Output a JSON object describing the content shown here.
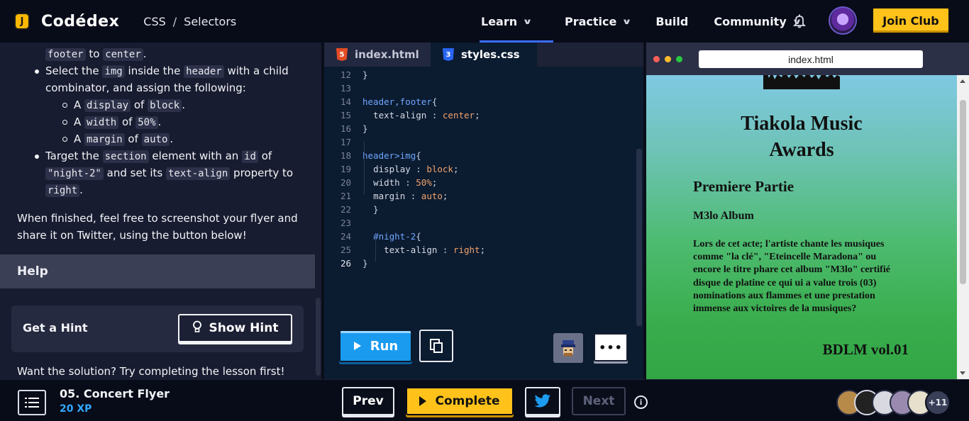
{
  "brand": {
    "name": "Codédex",
    "badge": "J"
  },
  "breadcrumb": {
    "course": "CSS",
    "separator": "/",
    "lesson": "Selectors"
  },
  "nav": {
    "learn": "Learn",
    "practice": "Practice",
    "build": "Build",
    "community": "Community",
    "join": "Join Club"
  },
  "lesson": {
    "frag_top_a": "footer",
    "frag_top_to": "to",
    "frag_top_b": "center",
    "b1_pre": "Select the",
    "b1_code1": "img",
    "b1_mid": "inside the",
    "b1_code2": "header",
    "b1_post": "with a child",
    "b1_line2": "combinator, and assign the following:",
    "sub1_pre": "A",
    "sub1_code": "display",
    "sub1_of": "of",
    "sub1_val": "block",
    "sub2_pre": "A",
    "sub2_code": "width",
    "sub2_of": "of",
    "sub2_val": "50%",
    "sub3_pre": "A",
    "sub3_code": "margin",
    "sub3_of": "of",
    "sub3_val": "auto",
    "b2_pre": "Target the",
    "b2_code1": "section",
    "b2_mid": "element with an",
    "b2_code2": "id",
    "b2_post": "of",
    "b2_code3": "\"night-2\"",
    "b2_mid2": "and set its",
    "b2_code4": "text-align",
    "b2_post2": "property to",
    "b2_code5": "right",
    "para": "When finished, feel free to screenshot your flyer and share it on Twitter, using the button below!",
    "help": "Help",
    "hint_label": "Get a Hint",
    "hint_button": "Show Hint",
    "solution": "Want the solution? Try completing the lesson first!"
  },
  "editor": {
    "tabs": [
      {
        "label": "index.html",
        "icon": "html5-icon"
      },
      {
        "label": "styles.css",
        "icon": "css3-icon"
      }
    ],
    "lines": [
      {
        "n": "12",
        "code": "}"
      },
      {
        "n": "13",
        "code": ""
      },
      {
        "n": "14",
        "code": "header,footer{"
      },
      {
        "n": "15",
        "code": "  text-align : center;"
      },
      {
        "n": "16",
        "code": "}"
      },
      {
        "n": "17",
        "code": ""
      },
      {
        "n": "18",
        "code": "header>img{"
      },
      {
        "n": "19",
        "code": "  display : block;"
      },
      {
        "n": "20",
        "code": "  width : 50%;"
      },
      {
        "n": "21",
        "code": "  margin : auto;"
      },
      {
        "n": "22",
        "code": "  }"
      },
      {
        "n": "23",
        "code": ""
      },
      {
        "n": "24",
        "code": "  #night-2{"
      },
      {
        "n": "25",
        "code": "    text-align : right;"
      },
      {
        "n": "26",
        "code": "}"
      }
    ],
    "run": "Run"
  },
  "preview": {
    "url": "index.html",
    "title_line1": "Tiakola Music",
    "title_line2": "Awards",
    "h2": "Premiere Partie",
    "h3": "M3lo Album",
    "paragraph": "Lors de cet acte; l'artiste chante les musiques comme \"la clé\", \"Eteincelle Maradona\" ou encore le titre phare cet album \"M3lo\" certifié disque de platine ce qui ui a value trois (03) nominations aux flammes et une prestation immense aux victoires de la musiques?",
    "night": "BDLM vol.01"
  },
  "footer": {
    "lesson_title": "05. Concert Flyer",
    "xp": "20 XP",
    "prev": "Prev",
    "complete": "Complete",
    "next": "Next",
    "info": "i",
    "others": "+11"
  },
  "colors": {
    "accent_blue": "#3d6cff",
    "gold": "#ffc21a",
    "run_blue": "#1a9bf0",
    "xp_blue": "#2fa8ff"
  }
}
